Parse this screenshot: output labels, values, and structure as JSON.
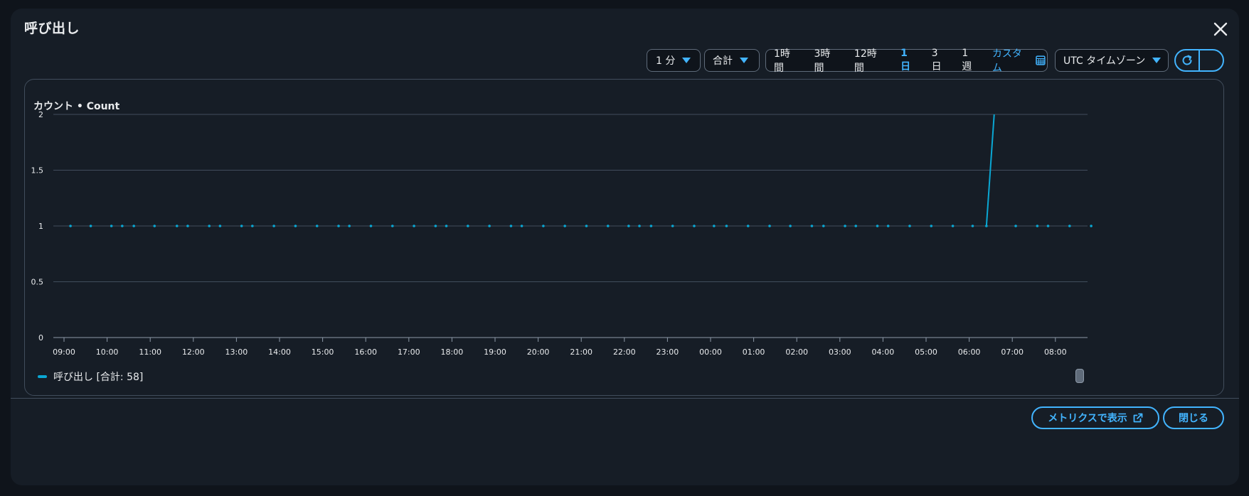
{
  "modal": {
    "title": "呼び出し"
  },
  "toolbar": {
    "period": "1 分",
    "statistic": "合計",
    "ranges": [
      "1時間",
      "3時間",
      "12時間",
      "1日",
      "3日",
      "1週"
    ],
    "active_range": "1日",
    "custom_label": "カスタム",
    "timezone": "UTC タイムゾーン"
  },
  "footer": {
    "view_metrics_label": "メトリクスで表示",
    "close_label": "閉じる"
  },
  "colors": {
    "accent": "#42b4ff",
    "series": "#0aa7d3",
    "background": "#161d26"
  },
  "chart_data": {
    "type": "line",
    "title": "カウント • Count",
    "ylim": [
      0,
      2
    ],
    "yticks": [
      "0",
      "0.5",
      "1",
      "1.5",
      "2"
    ],
    "xticks": [
      "09:00",
      "10:00",
      "11:00",
      "12:00",
      "13:00",
      "14:00",
      "15:00",
      "16:00",
      "17:00",
      "18:00",
      "19:00",
      "20:00",
      "21:00",
      "22:00",
      "23:00",
      "00:00",
      "01:00",
      "02:00",
      "03:00",
      "04:00",
      "05:00",
      "06:00",
      "07:00",
      "08:00"
    ],
    "grid": true,
    "legend_position": "bottom-left",
    "series": [
      {
        "name": "呼び出し [合計: 58]",
        "x_hours": [
          9.15,
          9.62,
          10.1,
          10.35,
          10.62,
          11.1,
          11.62,
          11.87,
          12.37,
          12.62,
          13.12,
          13.37,
          13.87,
          14.37,
          14.87,
          15.37,
          15.62,
          16.12,
          16.62,
          17.12,
          17.62,
          17.87,
          18.37,
          18.87,
          19.37,
          19.62,
          20.12,
          20.62,
          21.12,
          21.62,
          22.1,
          22.35,
          22.62,
          23.12,
          23.62,
          24.08,
          24.37,
          24.87,
          25.37,
          25.85,
          26.35,
          26.62,
          27.12,
          27.37,
          27.87,
          28.12,
          28.62,
          29.12,
          29.62,
          30.08,
          30.4,
          30.58,
          31.08,
          31.58,
          31.83,
          32.33,
          32.83
        ],
        "values": [
          1,
          1,
          1,
          1,
          1,
          1,
          1,
          1,
          1,
          1,
          1,
          1,
          1,
          1,
          1,
          1,
          1,
          1,
          1,
          1,
          1,
          1,
          1,
          1,
          1,
          1,
          1,
          1,
          1,
          1,
          1,
          1,
          1,
          1,
          1,
          1,
          1,
          1,
          1,
          1,
          1,
          1,
          1,
          1,
          1,
          1,
          1,
          1,
          1,
          1,
          1,
          2,
          1,
          1,
          1,
          1,
          1
        ]
      }
    ]
  }
}
